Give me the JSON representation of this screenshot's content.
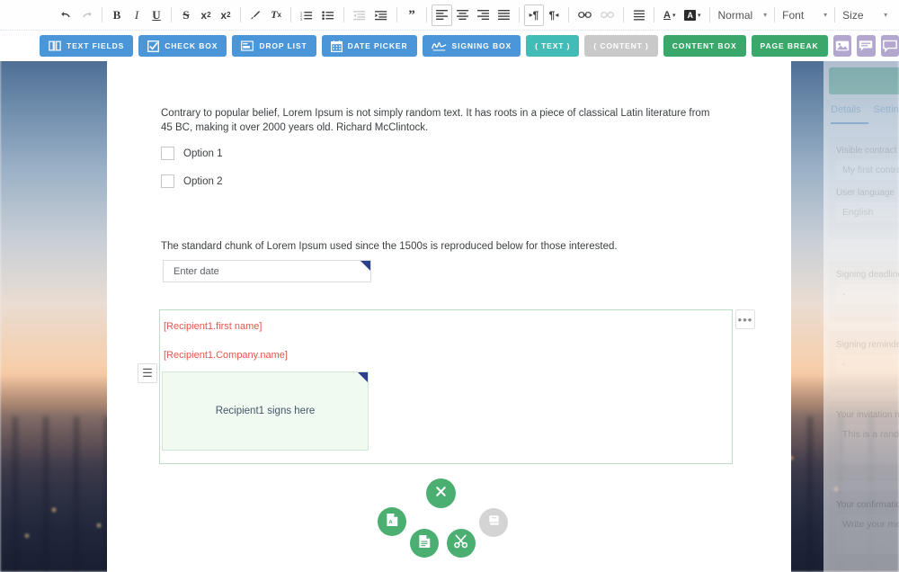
{
  "format_toolbar": {
    "buttons": [
      {
        "name": "undo-icon",
        "glyph": "↰",
        "state": "enabled"
      },
      {
        "name": "redo-icon",
        "glyph": "↱",
        "state": "disabled"
      },
      {
        "name": "bold-button",
        "glyph": "B",
        "state": "enabled"
      },
      {
        "name": "italic-button",
        "glyph": "I",
        "state": "enabled"
      },
      {
        "name": "underline-button",
        "glyph": "U",
        "state": "enabled"
      },
      {
        "name": "strikethrough-button",
        "glyph": "S",
        "state": "enabled"
      },
      {
        "name": "subscript-button",
        "glyph": "x₂",
        "state": "enabled"
      },
      {
        "name": "superscript-button",
        "glyph": "x²",
        "state": "enabled"
      },
      {
        "name": "format-painter-icon",
        "glyph": "✔",
        "state": "enabled"
      },
      {
        "name": "clear-formatting-button",
        "glyph": "Tx",
        "state": "enabled"
      },
      {
        "name": "numbered-list-button",
        "glyph": "list",
        "state": "enabled"
      },
      {
        "name": "bulleted-list-button",
        "glyph": "list",
        "state": "enabled"
      },
      {
        "name": "outdent-button",
        "glyph": "indent",
        "state": "disabled"
      },
      {
        "name": "indent-button",
        "glyph": "indent",
        "state": "enabled"
      },
      {
        "name": "blockquote-button",
        "glyph": "”",
        "state": "enabled"
      },
      {
        "name": "align-left-button",
        "glyph": "align",
        "state": "active"
      },
      {
        "name": "align-center-button",
        "glyph": "align",
        "state": "enabled"
      },
      {
        "name": "align-right-button",
        "glyph": "align",
        "state": "enabled"
      },
      {
        "name": "align-justify-button",
        "glyph": "align",
        "state": "enabled"
      },
      {
        "name": "ltr-direction-button",
        "glyph": "¶",
        "state": "active"
      },
      {
        "name": "rtl-direction-button",
        "glyph": "¶",
        "state": "enabled"
      },
      {
        "name": "insert-link-button",
        "glyph": "link",
        "state": "enabled"
      },
      {
        "name": "unlink-button",
        "glyph": "unlink",
        "state": "disabled"
      },
      {
        "name": "line-height-button",
        "glyph": "lines",
        "state": "enabled"
      },
      {
        "name": "text-color-button",
        "glyph": "A",
        "state": "enabled"
      },
      {
        "name": "background-color-button",
        "glyph": "A",
        "state": "enabled"
      }
    ],
    "selects": [
      {
        "name": "paragraph-style-select",
        "value": "Normal"
      },
      {
        "name": "font-family-select",
        "value": "Font"
      },
      {
        "name": "font-size-select",
        "value": "Size"
      }
    ]
  },
  "field_toolbar": {
    "buttons": [
      {
        "name": "text-fields-button",
        "label": "TEXT FIELDS",
        "color": "blue",
        "icon": "text-field-icon"
      },
      {
        "name": "check-box-button",
        "label": "CHECK BOX",
        "color": "blue",
        "icon": "checkbox-icon"
      },
      {
        "name": "drop-list-button",
        "label": "DROP LIST",
        "color": "blue",
        "icon": "droplist-icon"
      },
      {
        "name": "date-picker-button",
        "label": "DATE PICKER",
        "color": "blue",
        "icon": "calendar-icon"
      },
      {
        "name": "signing-box-button",
        "label": "SIGNING BOX",
        "color": "blue",
        "icon": "signature-icon"
      },
      {
        "name": "text-token-button",
        "label": "( TEXT )",
        "color": "teal",
        "icon": ""
      },
      {
        "name": "content-token-button",
        "label": "( CONTENT )",
        "color": "gray",
        "icon": ""
      },
      {
        "name": "content-box-button",
        "label": "CONTENT BOX",
        "color": "green",
        "icon": ""
      },
      {
        "name": "page-break-button",
        "label": "PAGE BREAK",
        "color": "green",
        "icon": ""
      },
      {
        "name": "insert-image-button",
        "label": "",
        "color": "purple",
        "icon": "image-icon"
      },
      {
        "name": "insert-comment-button",
        "label": "",
        "color": "purple",
        "icon": "comment-lines-icon"
      },
      {
        "name": "insert-bubble-button",
        "label": "",
        "color": "purple",
        "icon": "speech-bubble-icon"
      }
    ]
  },
  "document": {
    "paragraph_1": "Contrary to popular belief, Lorem Ipsum is not simply random text. It has roots in a piece of classical Latin literature from 45 BC, making it over 2000 years old. Richard McClintock.",
    "checkbox_1_label": "Option 1",
    "checkbox_2_label": "Option 2",
    "paragraph_2": "The standard chunk of Lorem Ipsum used since the 1500s is reproduced below for those interested.",
    "date_field_placeholder": "Enter date",
    "content_box": {
      "token_1": "[Recipient1.first name]",
      "token_2": "[Recipient1.Company.name]",
      "signing_box_label": "Recipient1 signs here",
      "drag_handle_glyph": "☰",
      "more_menu_glyph": "•••"
    }
  },
  "floating_actions": [
    {
      "name": "close-action-button",
      "icon": "close-icon",
      "color": "#4caf72"
    },
    {
      "name": "pdf-action-button",
      "icon": "pdf-file-icon",
      "color": "#4caf72"
    },
    {
      "name": "document-action-button",
      "icon": "document-icon",
      "color": "#4caf72"
    },
    {
      "name": "cut-action-button",
      "icon": "scissors-icon",
      "color": "#4caf72"
    },
    {
      "name": "library-action-button",
      "icon": "book-icon",
      "color": "#d4d4d4"
    }
  ],
  "sidebar": {
    "tabs": [
      {
        "name": "tab-details",
        "label": "Details"
      },
      {
        "name": "tab-settings",
        "label": "Settings"
      }
    ],
    "fields": [
      {
        "name": "visible-contract-name-field",
        "label": "Visible contract name",
        "value": "My first contract"
      },
      {
        "name": "user-language-field",
        "label": "User language",
        "value": "English"
      },
      {
        "name": "signing-deadline-field",
        "label": "Signing deadline",
        "value": "-"
      },
      {
        "name": "signing-reminder-field",
        "label": "Signing reminder",
        "value": "-"
      },
      {
        "name": "invitation-message-field",
        "label": "Your invitation message",
        "value": "This is a random invitation"
      },
      {
        "name": "confirmation-message-field",
        "label": "Your confirmation message",
        "value": "Write your message"
      }
    ]
  },
  "colors": {
    "primary_blue": "#4a96d9",
    "teal": "#41bcb6",
    "green": "#3aa86a",
    "purple": "#b3a7cf",
    "gray": "#c9c9c9",
    "token_red": "#e2564a",
    "flag_navy": "#2b3f8c",
    "signing_green_bg": "#f0faf1"
  }
}
